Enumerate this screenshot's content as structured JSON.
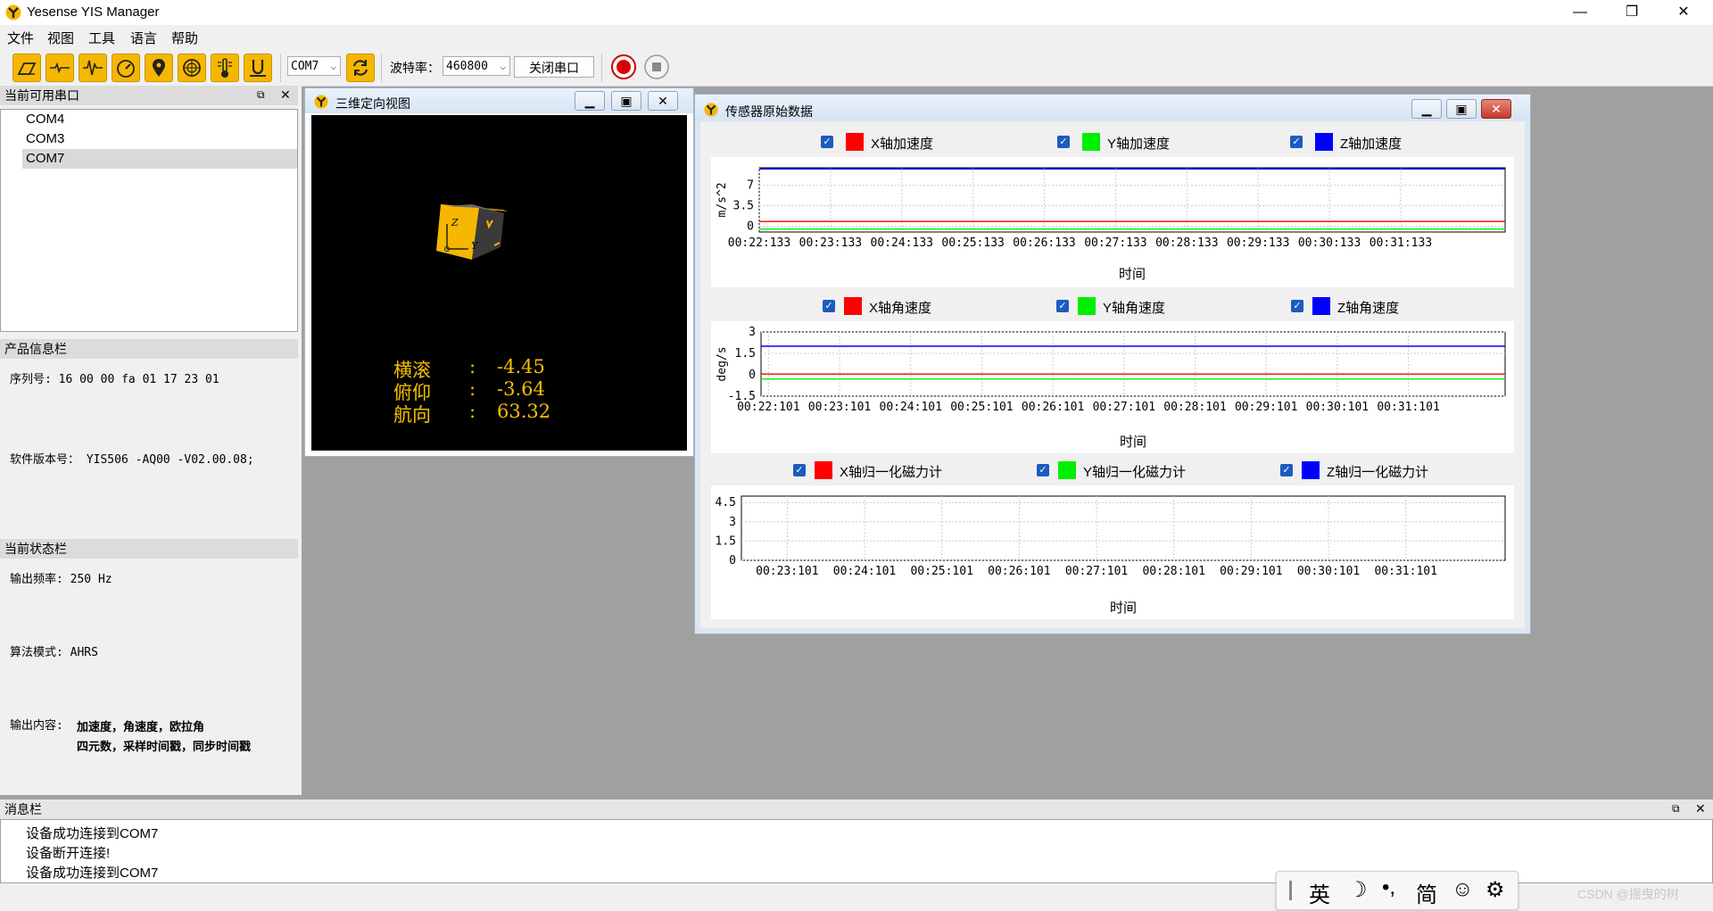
{
  "app": {
    "title": "Yesense YIS Manager"
  },
  "menu": [
    "文件",
    "视图",
    "工具",
    "语言",
    "帮助"
  ],
  "toolbar": {
    "port_value": "COM7",
    "baud_label": "波特率：",
    "baud_value": "460800",
    "close_port_label": "关闭串口",
    "icons": [
      "tilt-icon",
      "waveform-flat-icon",
      "waveform-icon",
      "speedometer-icon",
      "location-pin-icon",
      "gps-icon",
      "thermometer-icon",
      "magnet-icon"
    ]
  },
  "ports_dock": {
    "title": "当前可用串口",
    "ports": [
      "COM4",
      "COM3",
      "COM7"
    ],
    "selected": "COM7"
  },
  "product_dock": {
    "title": "产品信息栏",
    "serial": "序列号: 16 00 00 fa 01 17 23 01",
    "software": "软件版本号： YIS506 -AQ00 -V02.00.08;"
  },
  "status_dock": {
    "title": "当前状态栏",
    "freq": "输出频率: 250 Hz",
    "algo": "算法模式: AHRS",
    "output_label": "输出内容:",
    "output_line1": "加速度，角速度，欧拉角",
    "output_line2": "四元数，采样时间戳，同步时间戳"
  },
  "view3d": {
    "title": "三维定向视图",
    "roll_label": "横滚",
    "roll_value": "-4.45",
    "pitch_label": "俯仰",
    "pitch_value": "-3.64",
    "yaw_label": "航向",
    "yaw_value": "63.32",
    "colon": ":",
    "axis_z": "Z",
    "axis_y": "Y"
  },
  "sensor": {
    "title": "传感器原始数据",
    "accel_legend": [
      "X轴加速度",
      "Y轴加速度",
      "Z轴加速度"
    ],
    "gyro_legend": [
      "X轴角速度",
      "Y轴角速度",
      "Z轴角速度"
    ],
    "mag_legend": [
      "X轴归一化磁力计",
      "Y轴归一化磁力计",
      "Z轴归一化磁力计"
    ],
    "colors": {
      "x": "#ff0000",
      "y": "#00ee00",
      "z": "#0000ff"
    }
  },
  "chart_data": [
    {
      "type": "line",
      "ylabel": "m/s^2",
      "xlabel": "时间",
      "yticks": [
        "7",
        "3.5",
        "0"
      ],
      "ylim": [
        -1,
        10
      ],
      "x": [
        "00:22:133",
        "00:23:133",
        "00:24:133",
        "00:25:133",
        "00:26:133",
        "00:27:133",
        "00:28:133",
        "00:29:133",
        "00:30:133",
        "00:31:133"
      ],
      "series": [
        {
          "name": "X轴加速度",
          "values": [
            0.8,
            0.8,
            0.8,
            0.8,
            0.8,
            0.8,
            0.8,
            0.8,
            0.8,
            0.8
          ]
        },
        {
          "name": "Y轴加速度",
          "values": [
            -0.5,
            -0.5,
            -0.5,
            -0.5,
            -0.5,
            -0.5,
            -0.5,
            -0.5,
            -0.5,
            -0.5
          ]
        },
        {
          "name": "Z轴加速度",
          "values": [
            9.8,
            9.8,
            9.8,
            9.8,
            9.8,
            9.8,
            9.8,
            9.8,
            9.8,
            9.8
          ]
        }
      ]
    },
    {
      "type": "line",
      "ylabel": "deg/s",
      "xlabel": "时间",
      "yticks": [
        "3",
        "1.5",
        "0",
        "-1.5"
      ],
      "ylim": [
        -1.5,
        3
      ],
      "x": [
        "00:22:101",
        "00:23:101",
        "00:24:101",
        "00:25:101",
        "00:26:101",
        "00:27:101",
        "00:28:101",
        "00:29:101",
        "00:30:101",
        "00:31:101"
      ],
      "series": [
        {
          "name": "X轴角速度",
          "values": [
            0.05,
            0.05,
            0.05,
            0.05,
            0.05,
            0.05,
            0.05,
            0.05,
            0.05,
            0.05
          ]
        },
        {
          "name": "Y轴角速度",
          "values": [
            -0.3,
            -0.3,
            -0.3,
            -0.3,
            -0.3,
            -0.3,
            -0.3,
            -0.3,
            -0.3,
            -0.3
          ]
        },
        {
          "name": "Z轴角速度",
          "values": [
            2.0,
            2.0,
            2.0,
            2.0,
            2.0,
            2.0,
            2.0,
            2.0,
            2.0,
            2.0
          ]
        }
      ]
    },
    {
      "type": "line",
      "xlabel": "时间",
      "yticks": [
        "4.5",
        "3",
        "1.5",
        "0"
      ],
      "ylim": [
        0,
        5
      ],
      "x": [
        "00:23:101",
        "00:24:101",
        "00:25:101",
        "00:26:101",
        "00:27:101",
        "00:28:101",
        "00:29:101",
        "00:30:101",
        "00:31:101"
      ],
      "series": []
    }
  ],
  "messages": {
    "title": "消息栏",
    "lines": [
      "设备成功连接到COM7",
      "设备断开连接!",
      "设备成功连接到COM7"
    ]
  },
  "ime": {
    "items": [
      "英",
      "简"
    ]
  },
  "watermark": "CSDN @摇曳的树"
}
